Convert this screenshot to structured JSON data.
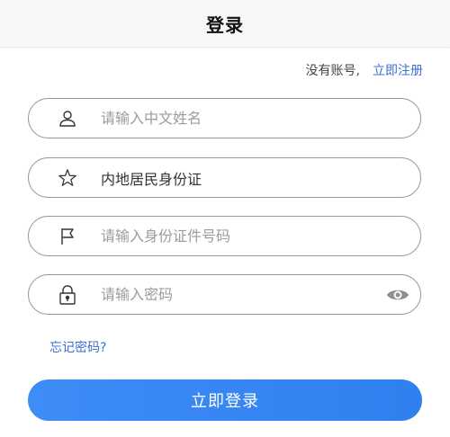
{
  "header": {
    "title": "登录"
  },
  "register": {
    "no_account_text": "没有账号,",
    "register_link": "立即注册"
  },
  "form": {
    "name_field": {
      "placeholder": "请输入中文姓名",
      "icon": "person-icon"
    },
    "id_type_field": {
      "value": "内地居民身份证",
      "icon": "star-icon"
    },
    "id_number_field": {
      "placeholder": "请输入身份证件号码",
      "icon": "flag-icon"
    },
    "password_field": {
      "placeholder": "请输入密码",
      "icon": "lock-icon",
      "toggle_icon": "eye-icon"
    }
  },
  "forgot_password": "忘记密码?",
  "login_button": "立即登录",
  "colors": {
    "accent": "#3b6fd3",
    "button": "#3385f3",
    "border": "#9a9a9a"
  }
}
